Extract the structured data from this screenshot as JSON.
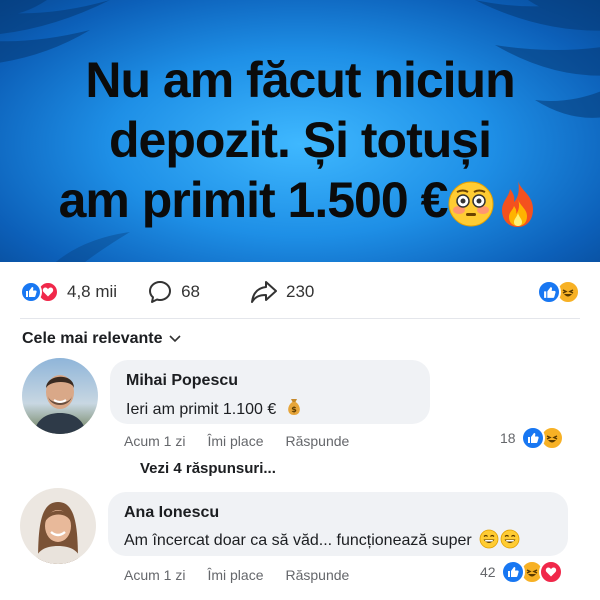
{
  "hero": {
    "line1": "Nu am făcut niciun",
    "line2": "depozit. Și totuși",
    "line3": "am primit 1.500 €",
    "emojis": [
      "flushed-face",
      "fire"
    ]
  },
  "reactions_bar": {
    "reactions_count": "4,8 mii",
    "comments_count": "68",
    "shares_count": "230"
  },
  "sort": {
    "label": "Cele mai relevante"
  },
  "comments": [
    {
      "author": "Mihai Popescu",
      "text": "Ieri am primit 1.100 €",
      "emoji": "money-bag",
      "time": "Acum 1 zi",
      "like_label": "Îmi place",
      "reply_label": "Răspunde",
      "reaction_count": "18",
      "reactions": [
        "like",
        "haha"
      ]
    },
    {
      "author": "Ana Ionescu",
      "text": "Am încercat doar ca să văd... funcționează super",
      "emoji": "grinning-face",
      "time": "Acum 1 zi",
      "like_label": "Îmi place",
      "reply_label": "Răspunde",
      "reaction_count": "42",
      "reactions": [
        "like",
        "haha",
        "love"
      ]
    }
  ],
  "view_replies": "Vezi 4 răspunsuri...",
  "colors": {
    "brand_blue": "#1877f2",
    "love_red": "#f0284a",
    "haha_yellow": "#f7b125",
    "bubble_gray": "#f0f2f5"
  }
}
